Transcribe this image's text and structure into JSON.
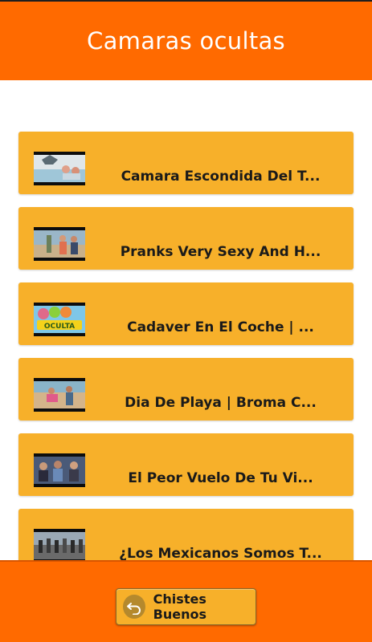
{
  "app": {
    "title": "Camaras ocultas"
  },
  "colors": {
    "header": "#ff6a00",
    "card": "#f7b02a",
    "text": "#1a1a1a"
  },
  "videos": [
    {
      "title": "Camara Escondida Del T...",
      "thumbnail": "shark-pool-thumbnail"
    },
    {
      "title": "Pranks Very Sexy And H...",
      "thumbnail": "beach-prank-thumbnail"
    },
    {
      "title": "Cadaver En El Coche | ...",
      "thumbnail": "camara-oculta-logo-thumbnail"
    },
    {
      "title": "Dia De Playa | Broma C...",
      "thumbnail": "beach-day-thumbnail"
    },
    {
      "title": "El Peor Vuelo De Tu Vi...",
      "thumbnail": "airplane-thumbnail"
    },
    {
      "title": "¿Los Mexicanos Somos T...",
      "thumbnail": "street-crowd-thumbnail"
    }
  ],
  "footer": {
    "button_label": "Chistes Buenos",
    "button_icon": "back-arrow-icon"
  }
}
